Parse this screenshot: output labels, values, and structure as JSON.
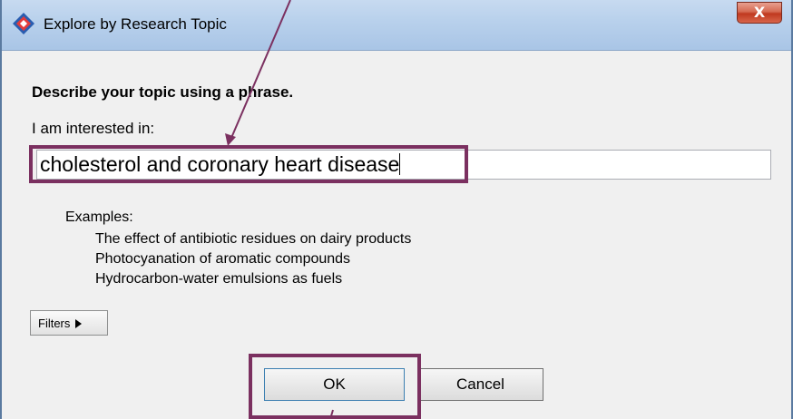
{
  "window": {
    "title": "Explore by Research Topic",
    "close_label": "X"
  },
  "form": {
    "heading": "Describe your topic using a phrase.",
    "label": "I am interested in:",
    "topic_value": "cholesterol and coronary heart disease",
    "examples_title": "Examples:",
    "examples": [
      "The effect of antibiotic residues on dairy products",
      "Photocyanation of aromatic compounds",
      "Hydrocarbon-water emulsions as fuels"
    ]
  },
  "buttons": {
    "filters_label": "Filters",
    "ok_label": "OK",
    "cancel_label": "Cancel"
  },
  "annotations": {
    "highlight_color": "#7b3060",
    "arrow_color": "#7b3060"
  },
  "icons": {
    "app": "app-diamond-icon",
    "close": "close-icon",
    "filters_arrow": "triangle-right-icon"
  }
}
